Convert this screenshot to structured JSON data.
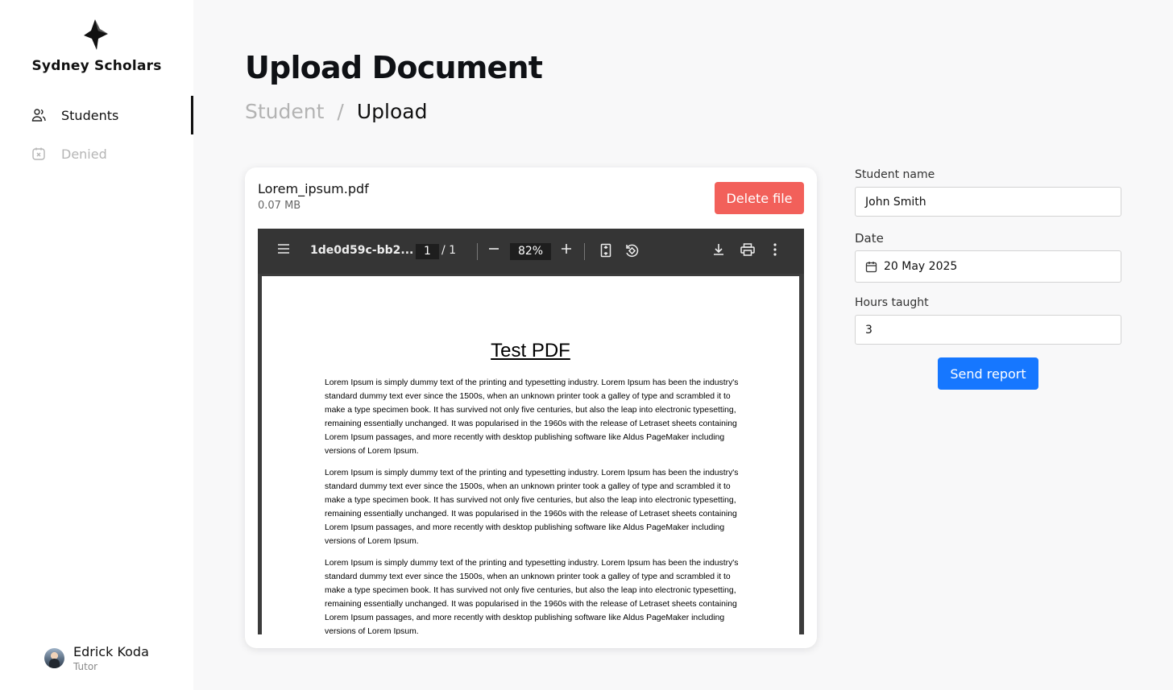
{
  "sidebar": {
    "brand": "Sydney Scholars",
    "items": [
      {
        "label": "Students",
        "icon": "users-icon",
        "active": true
      },
      {
        "label": "Denied",
        "icon": "calendar-x-icon",
        "active": false
      }
    ],
    "user": {
      "name": "Edrick Koda",
      "role": "Tutor"
    }
  },
  "header": {
    "title": "Upload Document",
    "breadcrumb": {
      "previous": "Student",
      "separator": "/",
      "current": "Upload"
    }
  },
  "file": {
    "name": "Lorem_ipsum.pdf",
    "size": "0.07 MB",
    "delete_label": "Delete file"
  },
  "viewer": {
    "doc_title": "1de0d59c-bb2...",
    "page_current": "1",
    "page_total": "/  1",
    "zoom": "82%",
    "pdf_title": "Test PDF",
    "paragraphs": [
      "Lorem Ipsum is simply dummy text of the printing and typesetting industry. Lorem Ipsum has been the industry's standard dummy text ever since the 1500s, when an unknown printer took a galley of type and scrambled it to make a type specimen book. It has survived not only five centuries, but also the leap into electronic typesetting, remaining essentially unchanged. It was popularised in the 1960s with the release of Letraset sheets containing Lorem Ipsum passages, and more recently with desktop publishing software like Aldus PageMaker including versions of Lorem Ipsum.",
      "Lorem Ipsum is simply dummy text of the printing and typesetting industry. Lorem Ipsum has been the industry's standard dummy text ever since the 1500s, when an unknown printer took a galley of type and scrambled it to make a type specimen book. It has survived not only five centuries, but also the leap into electronic typesetting, remaining essentially unchanged. It was popularised in the 1960s with the release of Letraset sheets containing Lorem Ipsum passages, and more recently with desktop publishing software like Aldus PageMaker including versions of Lorem Ipsum.",
      "Lorem Ipsum is simply dummy text of the printing and typesetting industry. Lorem Ipsum has been the industry's standard dummy text ever since the 1500s, when an unknown printer took a galley of type and scrambled it to make a type specimen book. It has survived not only five centuries, but also the leap into electronic typesetting, remaining essentially unchanged. It was popularised in the 1960s with the release of Letraset sheets containing Lorem Ipsum passages, and more recently with desktop publishing software like Aldus PageMaker including versions of Lorem Ipsum."
    ]
  },
  "form": {
    "student_name_label": "Student name",
    "student_name_value": "John Smith",
    "date_label": "Date",
    "date_value": "20 May 2025",
    "hours_label": "Hours taught",
    "hours_value": "3",
    "send_label": "Send report"
  },
  "colors": {
    "danger": "#f2605a",
    "primary": "#1677ff",
    "background": "#f8f8f9"
  }
}
